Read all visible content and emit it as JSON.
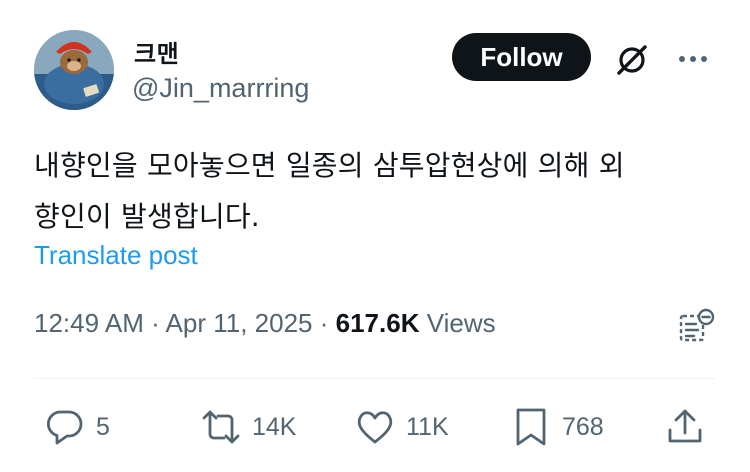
{
  "author": {
    "display_name": "크맨",
    "handle": "@Jin_marrring",
    "avatar": "avatar-bear-with-red-hat"
  },
  "follow_label": "Follow",
  "post": {
    "text": "내향인을 모아놓으면 일종의 삼투압현상에 의해 외\n향인이 발생합니다.",
    "translate_label": "Translate post"
  },
  "meta": {
    "time": "12:49 AM",
    "date": "Apr 11, 2025",
    "views_count": "617.6K",
    "views_label": "Views"
  },
  "actions": {
    "replies": "5",
    "reposts": "14K",
    "likes": "11K",
    "bookmarks": "768"
  },
  "icons": [
    "grok-icon",
    "more-icon",
    "analytics-icon",
    "reply-icon",
    "repost-icon",
    "like-icon",
    "bookmark-icon",
    "share-icon"
  ],
  "colors": {
    "text": "#0f1419",
    "muted": "#536471",
    "link": "#1d9bf0",
    "button": "#0f1419"
  }
}
